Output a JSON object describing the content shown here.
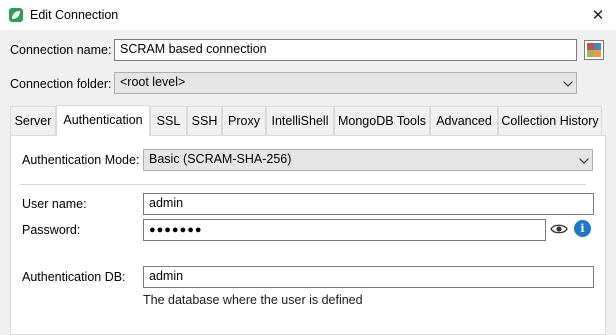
{
  "window": {
    "title": "Edit Connection",
    "close_glyph": "✕"
  },
  "form": {
    "connection_name_label": "Connection name:",
    "connection_name_value": "SCRAM based connection",
    "connection_folder_label": "Connection folder:",
    "connection_folder_value": "<root level>"
  },
  "tabs": [
    {
      "label": "Server"
    },
    {
      "label": "Authentication"
    },
    {
      "label": "SSL"
    },
    {
      "label": "SSH"
    },
    {
      "label": "Proxy"
    },
    {
      "label": "IntelliShell"
    },
    {
      "label": "MongoDB Tools"
    },
    {
      "label": "Advanced"
    },
    {
      "label": "Collection History"
    }
  ],
  "active_tab": "Authentication",
  "auth": {
    "mode_label": "Authentication Mode:",
    "mode_value": "Basic (SCRAM-SHA-256)",
    "username_label": "User name:",
    "username_value": "admin",
    "password_label": "Password:",
    "password_value": "●●●●●●●",
    "info_glyph": "i",
    "authdb_label": "Authentication DB:",
    "authdb_value": "admin",
    "authdb_hint": "The database where the user is defined"
  },
  "colors": {
    "app_icon": "#2e9e5b",
    "info": "#1f77c9",
    "color_swatch": [
      "#c0504d",
      "#4f81bd",
      "#9bbb59",
      "#f79646"
    ]
  },
  "icons": {
    "app": "leaf-icon",
    "color_picker": "color-palette-icon",
    "show_password": "eye-icon",
    "info": "info-icon",
    "dropdown": "chevron-down-icon"
  }
}
